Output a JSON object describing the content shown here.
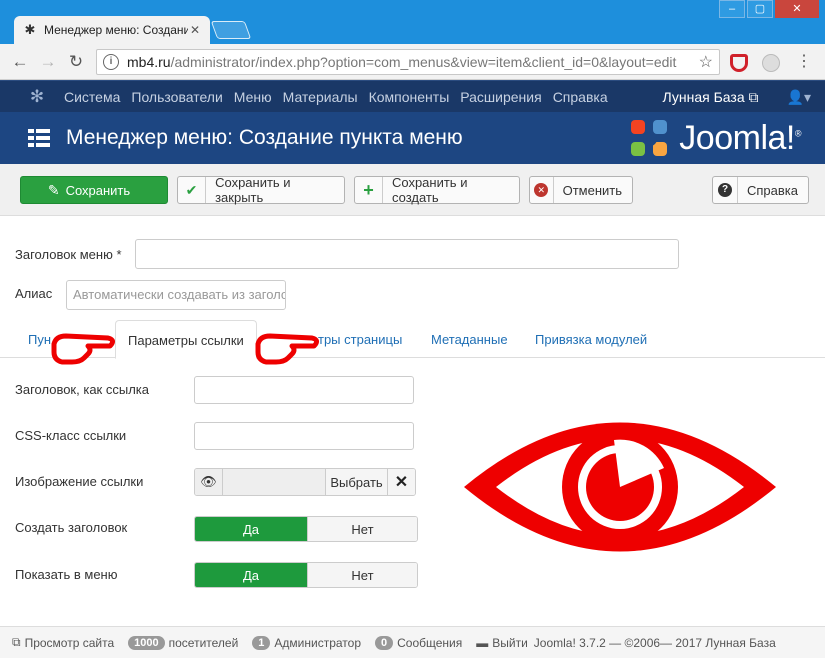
{
  "browser": {
    "tab_title": "Менеджер меню: Создание",
    "url_host": "mb4.ru",
    "url_path": "/administrator/index.php?option=com_menus&view=item&client_id=0&layout=edit",
    "accent": "#1e8fdc"
  },
  "nav": {
    "items": [
      "Система",
      "Пользователи",
      "Меню",
      "Материалы",
      "Компоненты",
      "Расширения",
      "Справка"
    ],
    "site_name": "Лунная База ⧉"
  },
  "header": {
    "title": "Менеджер меню: Создание пункта меню",
    "brand": "Joomla!",
    "brand_mark": "®"
  },
  "toolbar": {
    "save": "Сохранить",
    "save_close": "Сохранить и закрыть",
    "save_new": "Сохранить и создать",
    "cancel": "Отменить",
    "help": "Справка",
    "save_color": "#2aa040"
  },
  "form": {
    "title_label": "Заголовок меню *",
    "title_value": "",
    "alias_label": "Алиас",
    "alias_placeholder": "Автоматически создавать из заголовка"
  },
  "tabs": {
    "item_details": "Пун",
    "link_params": "Параметры ссылки",
    "page_params": "тры страницы",
    "metadata": "Метаданные",
    "modules": "Привязка модулей"
  },
  "link_params": {
    "link_title_label": "Заголовок, как ссылка",
    "css_class_label": "CSS-класс ссылки",
    "image_label": "Изображение ссылки",
    "image_select": "Выбрать",
    "create_title_label": "Создать заголовок",
    "show_in_menu_label": "Показать в меню",
    "yes": "Да",
    "no": "Нет"
  },
  "overlay": {
    "color": "#ee0000"
  },
  "status": {
    "view_site": "Просмотр сайта",
    "visitors_count": "1000",
    "visitors_label": "посетителей",
    "admins_count": "1",
    "admins_label": "Администратор",
    "messages_count": "0",
    "messages_label": "Сообщения",
    "logout": "Выйти",
    "version": "Joomla! 3.7.2 — ©2006— 2017 Лунная База"
  }
}
